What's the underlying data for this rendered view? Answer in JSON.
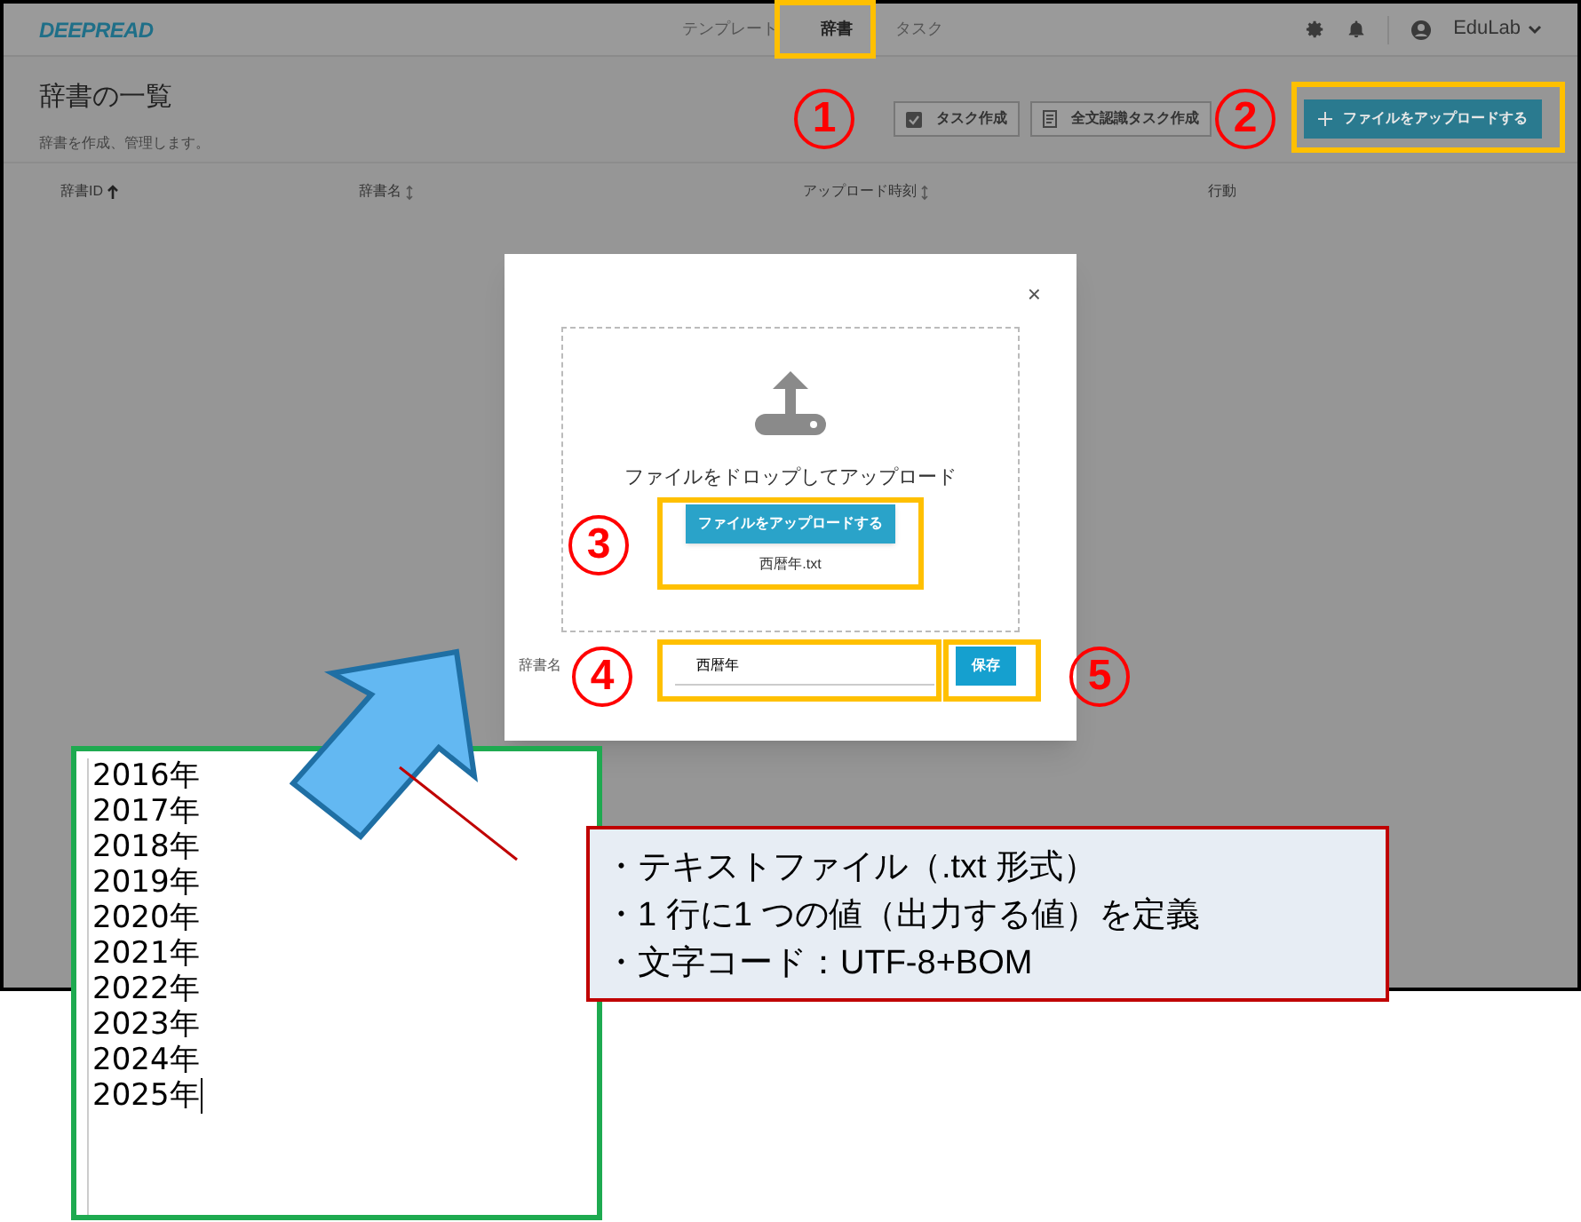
{
  "header": {
    "logo": "DEEPREAD",
    "nav": [
      {
        "label": "テンプレート",
        "selected": false
      },
      {
        "label": "辞書",
        "selected": true
      },
      {
        "label": "タスク",
        "selected": false
      }
    ],
    "user": "EduLab"
  },
  "page": {
    "title": "辞書の一覧",
    "subtitle": "辞書を作成、管理します。",
    "actions": [
      {
        "kind": "task",
        "label": "タスク作成"
      },
      {
        "kind": "fulltext",
        "label": "全文認識タスク作成"
      },
      {
        "kind": "upload",
        "label": "ファイルをアップロードする"
      }
    ],
    "columns": [
      {
        "label": "辞書ID",
        "sortable": true,
        "sorted_ascending": true
      },
      {
        "label": "辞書名",
        "sortable": true,
        "sorted_ascending": false
      },
      {
        "label": "アップロード時刻",
        "sortable": true,
        "sorted_ascending": false
      },
      {
        "label": "行動",
        "sortable": false
      }
    ]
  },
  "modal": {
    "close": "×",
    "drop_text": "ファイルをドロップしてアップロード",
    "upload_button": "ファイルをアップロードする",
    "file_name": "西暦年.txt",
    "name_label": "辞書名",
    "name_value": "西暦年",
    "save_button": "保存"
  },
  "annotations": {
    "markers": [
      "1",
      "2",
      "3",
      "4",
      "5"
    ],
    "file_example": {
      "lines": [
        "2016年",
        "2017年",
        "2018年",
        "2019年",
        "2020年",
        "2021年",
        "2022年",
        "2023年",
        "2024年",
        "2025年"
      ]
    },
    "callout": {
      "lines": [
        "・テキストファイル（.txt 形式）",
        "・1 行に1 つの値（出力する値）を定義",
        "・文字コード：UTF-8+BOM"
      ]
    }
  }
}
